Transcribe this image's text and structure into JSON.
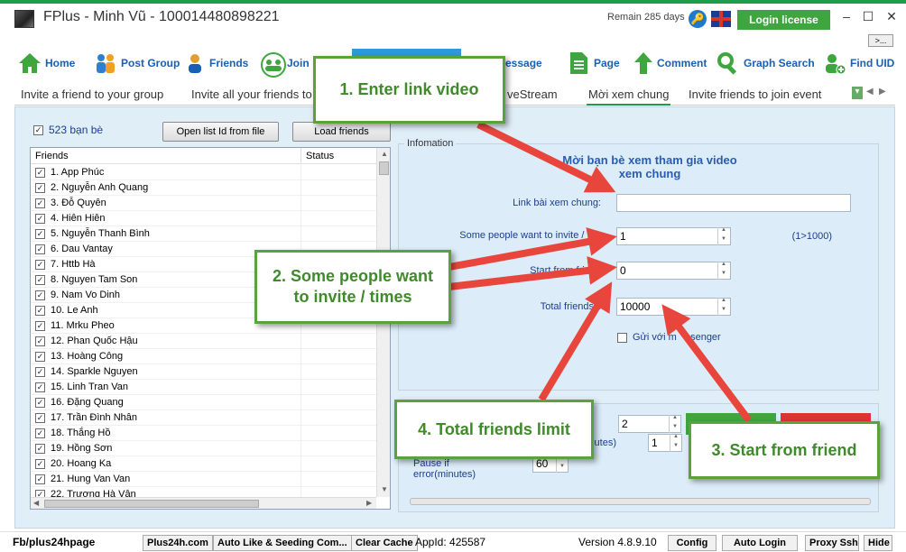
{
  "window": {
    "title": "FPlus - Minh Vũ - 100014480898221",
    "remain": "Remain 285 days",
    "login_label": "Login license",
    "minimize": "–",
    "maximize": "☐",
    "close": "✕",
    "expand_label": ">..."
  },
  "toolbar": {
    "items": [
      {
        "label": "Home",
        "icon": "house-icon"
      },
      {
        "label": "Post Group",
        "icon": "users-icon"
      },
      {
        "label": "Friends",
        "icon": "friend-icon"
      },
      {
        "label": "Join",
        "icon": "join-group-icon"
      },
      {
        "label": "essage",
        "icon": "message-icon"
      },
      {
        "label": "Page",
        "icon": "document-icon"
      },
      {
        "label": "Comment",
        "icon": "up-arrow-icon"
      },
      {
        "label": "Graph Search",
        "icon": "magnifier-icon"
      },
      {
        "label": "Find UID",
        "icon": "find-user-icon"
      }
    ]
  },
  "tabs": [
    "Invite a friend to your group",
    "Invite all your friends to",
    "veStream",
    "Mời xem chung",
    "Invite friends to join event"
  ],
  "left": {
    "friend_count": "523 bạn bè",
    "open_list_label": "Open list Id from file",
    "load_friends_label": "Load friends",
    "col_friends": "Friends",
    "col_status": "Status",
    "friends": [
      "1. App Phúc",
      "2. Nguyễn Anh Quang",
      "3. Đỗ Quyên",
      "4. Hiên Hiên",
      "5. Nguyễn Thanh Bình",
      "6. Dau Vantay",
      "7. Httb Hà",
      "8. Nguyen Tam Son",
      "9. Nam Vo Dinh",
      "10. Le Anh",
      "11. Mrku Pheo",
      "12. Phan Quốc Hậu",
      "13. Hoàng Công",
      "14. Sparkle Nguyen",
      "15. Linh Tran Van",
      "16. Đặng Quang",
      "17. Trần Đình Nhân",
      "18. Thắng Hồ",
      "19. Hồng Sơn",
      "20. Hoang Ka",
      "21. Hung Van Van",
      "22. Trương Hà Vân"
    ]
  },
  "info": {
    "legend": "Infomation",
    "heading_line1": "Mời bạn bè xem tham gia video",
    "heading_line2": "xem chung",
    "link_label": "Link bài xem chung:",
    "link_value": "",
    "some_label": "Some people want to invite / ti",
    "some_value": "1",
    "range_hint": "(1>1000)",
    "start_label": "Start from friend",
    "start_value": "0",
    "total_label": "Total friends li",
    "total_value": "10000",
    "messenger_label": "Gửi với m     senger"
  },
  "wait": {
    "value1": "2",
    "minutes_label": "inutes)",
    "value2": "1",
    "pause_label": "Pause if error(minutes)",
    "pause_value": "60"
  },
  "callouts": {
    "c1": "1. Enter link video",
    "c2_line1": "2. Some people want",
    "c2_line2": "to invite / times",
    "c3": "3. Start from friend",
    "c4": "4. Total friends limit"
  },
  "status": {
    "left_text": "Fb/plus24hpage",
    "btn1": "Plus24h.com",
    "btn2": "Auto Like & Seeding Com...",
    "btn3": "Clear Cache",
    "appid": "AppId: 425587",
    "version": "Version 4.8.9.10",
    "config": "Config",
    "autologin": "Auto Login",
    "proxy": "Proxy Ssh",
    "hide": "Hide"
  },
  "colors": {
    "accent_green": "#3fa63f",
    "callout_green": "#5da13d",
    "arrow_red": "#e8463c",
    "link_blue": "#1a5fb4"
  }
}
